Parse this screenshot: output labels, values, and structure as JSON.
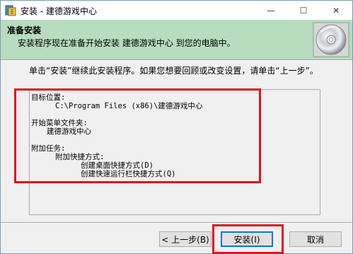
{
  "window": {
    "title": "安装 - 建德游戏中心",
    "icon": "installer-icon"
  },
  "caption_buttons": {
    "minimize": "—",
    "maximize": "☐",
    "close": "✕"
  },
  "header": {
    "title": "准备安装",
    "description": "安装程序现在准备开始安装 建德游戏中心 到您的电脑中。",
    "image": "cd-disc-icon"
  },
  "intro_text": "单击“安装”继续此安装程序。如果您想要回顾或改变设置，请单击“上一步”。",
  "summary": {
    "dest_label": "目标位置:",
    "dest_value": "C:\\Program Files (x86)\\建德游戏中心",
    "start_menu_label": "开始菜单文件夹:",
    "start_menu_value": "建德游戏中心",
    "tasks_label": "附加任务:",
    "shortcuts_label": "附加快捷方式:",
    "task1": "创建桌面快捷方式(D)",
    "task2": "创建快速运行栏快捷方式(Q)"
  },
  "buttons": {
    "back": "< 上一步(B)",
    "install": "安装(I)",
    "cancel": "取消"
  },
  "highlight_color": "#e0141e"
}
